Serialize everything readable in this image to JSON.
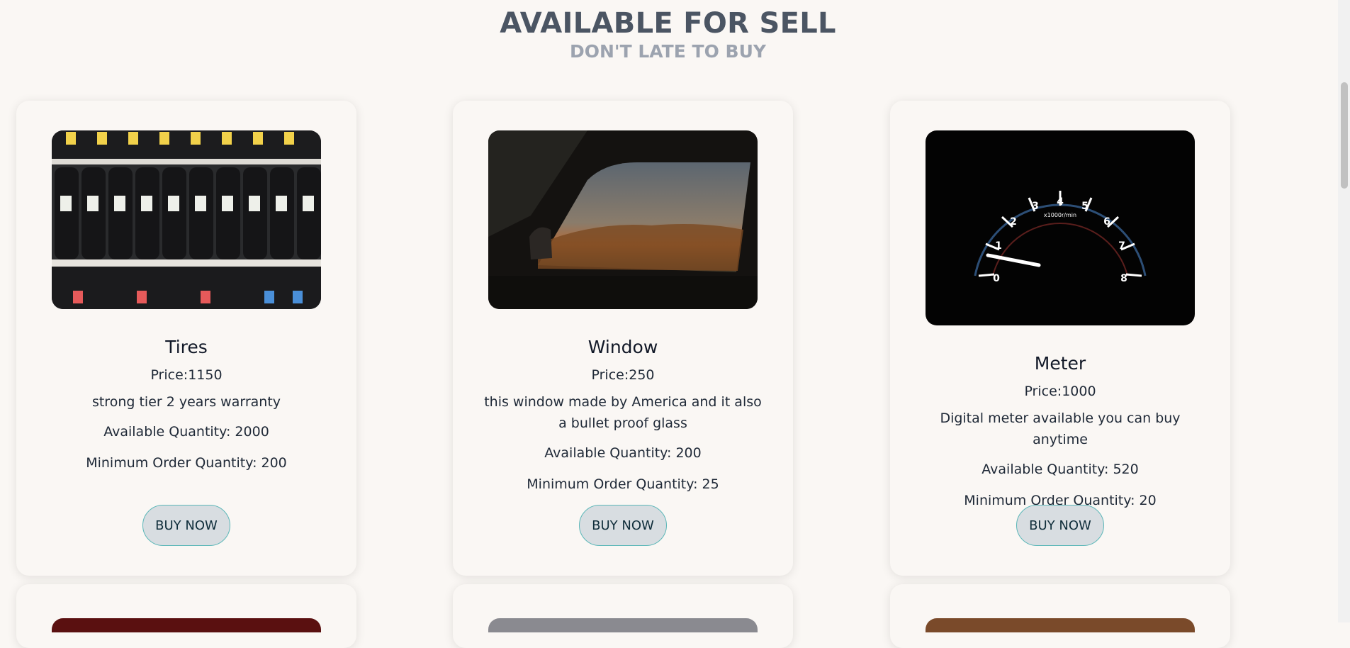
{
  "section": {
    "title": "AVAILABLE FOR SELL",
    "subtitle": "DON'T LATE TO BUY"
  },
  "products": [
    {
      "name": "Tires",
      "price": "Price:1150",
      "description": "strong tier 2 years warranty",
      "available": "Available Quantity: 2000",
      "minimum": "Minimum Order Quantity: 200",
      "button": "BUY NOW",
      "image_icon": "tires-photo"
    },
    {
      "name": "Window",
      "price": "Price:250",
      "description": "this window made by America and it also a bullet proof glass",
      "available": "Available Quantity: 200",
      "minimum": "Minimum Order Quantity: 25",
      "button": "BUY NOW",
      "image_icon": "car-window-photo"
    },
    {
      "name": "Meter",
      "price": "Price:1000",
      "description": "Digital meter available you can buy anytime",
      "available": "Available Quantity: 520",
      "minimum": "Minimum Order Quantity: 20",
      "button": "BUY NOW",
      "image_icon": "speedometer-photo",
      "gauge_labels": [
        "0",
        "1",
        "2",
        "3",
        "4",
        "5",
        "6",
        "7",
        "8"
      ],
      "gauge_unit": "x1000r/min"
    }
  ],
  "colors": {
    "background": "#faf7f4",
    "title": "#4b5563",
    "subtitle": "#9ca3af",
    "button_bg": "#d8dde1",
    "button_border": "#5bb7b8"
  }
}
